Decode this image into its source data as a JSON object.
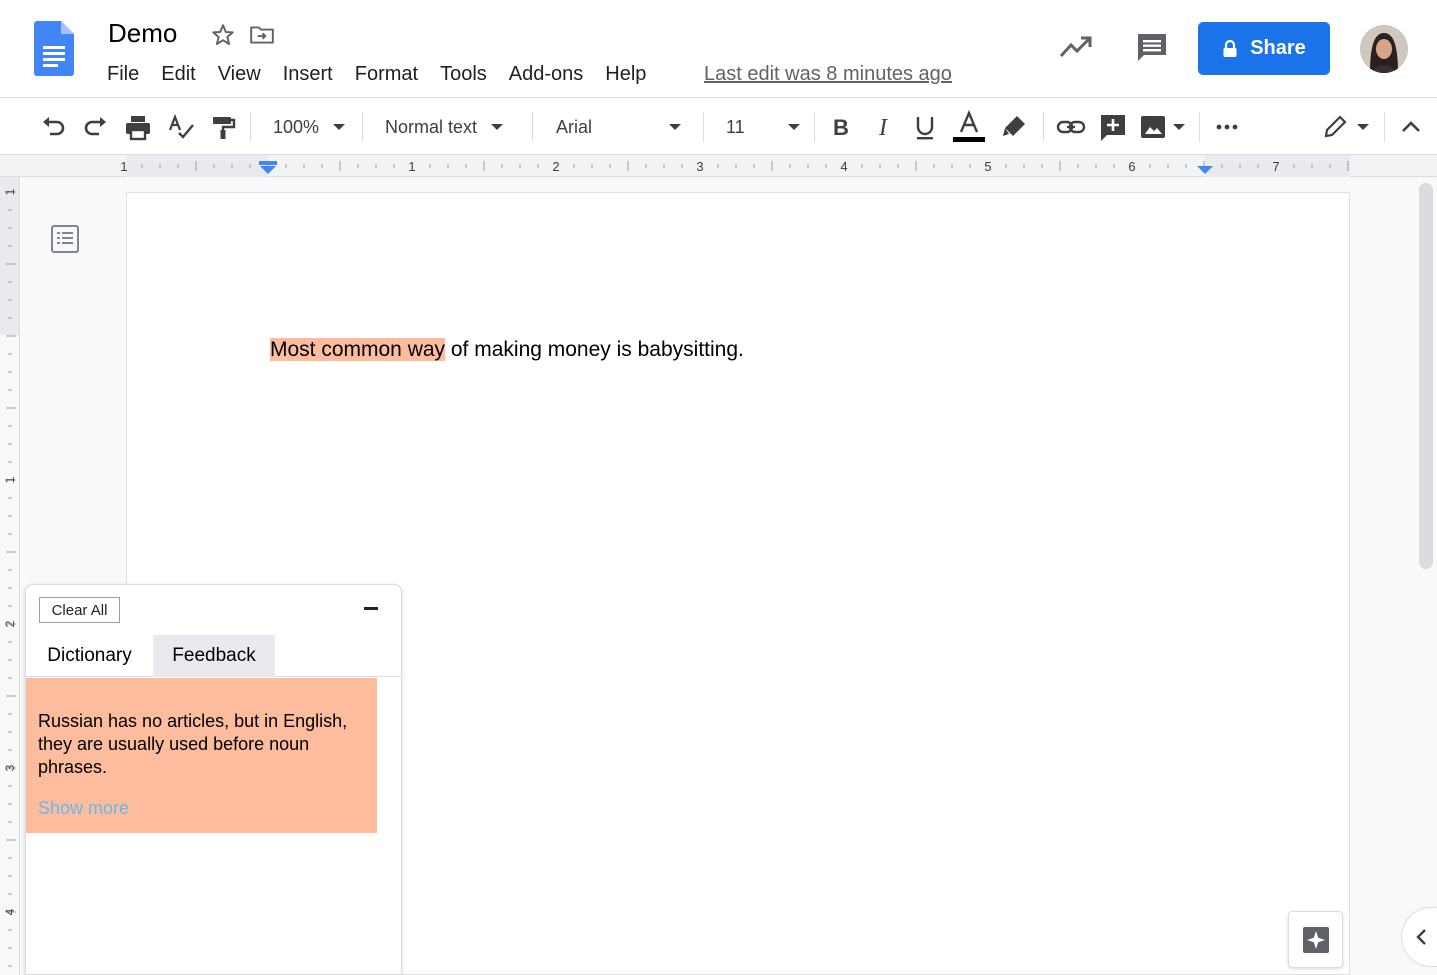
{
  "header": {
    "title": "Demo",
    "menu": [
      "File",
      "Edit",
      "View",
      "Insert",
      "Format",
      "Tools",
      "Add-ons",
      "Help"
    ],
    "last_edit": "Last edit was 8 minutes ago",
    "share_label": "Share"
  },
  "toolbar": {
    "zoom": "100%",
    "style": "Normal text",
    "font": "Arial",
    "size": "11"
  },
  "ruler": {
    "h_labels": [
      "1",
      "1",
      "2",
      "3",
      "4",
      "5",
      "6",
      "7"
    ],
    "v_labels": [
      "1",
      "1",
      "2",
      "3",
      "4"
    ]
  },
  "document": {
    "highlighted": "Most common way",
    "rest": " of making money is babysitting."
  },
  "panel": {
    "clear_label": "Clear All",
    "tabs": [
      "Dictionary",
      "Feedback"
    ],
    "card_text": "Russian has no articles, but in English, they are usually used before noun phrases.",
    "show_more": "Show more"
  },
  "colors": {
    "accent": "#1a73e8",
    "highlight": "#fdbc9e",
    "link": "#6bb8ea"
  }
}
